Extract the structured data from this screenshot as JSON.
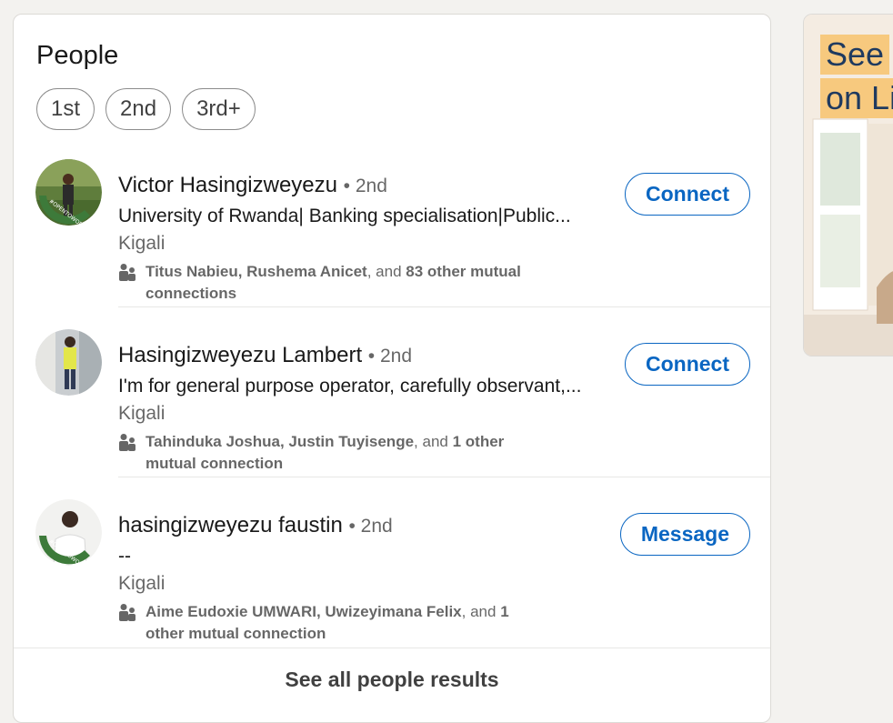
{
  "people_card": {
    "title": "People",
    "filters": [
      "1st",
      "2nd",
      "3rd+"
    ],
    "results": [
      {
        "name": "Victor Hasingizweyezu",
        "degree": "• 2nd",
        "headline": "University of Rwanda| Banking specialisation|Public...",
        "location": "Kigali",
        "mutual_names": "Titus Nabieu, Rushema Anicet",
        "mutual_joiner": ", and ",
        "mutual_count": "83 other mutual connections",
        "action": "Connect",
        "avatar_badge": "#OPENTOWORK"
      },
      {
        "name": "Hasingizweyezu Lambert",
        "degree": "• 2nd",
        "headline": "I'm for general purpose operator, carefully observant,...",
        "location": "Kigali",
        "mutual_names": "Tahinduka Joshua, Justin Tuyisenge",
        "mutual_joiner": ", and ",
        "mutual_count": "1 other mutual connection",
        "action": "Connect",
        "avatar_badge": ""
      },
      {
        "name": "hasingizweyezu faustin",
        "degree": "• 2nd",
        "headline": "--",
        "location": "Kigali",
        "mutual_names": "Aime Eudoxie UMWARI, Uwizeyimana Felix",
        "mutual_joiner": ", and ",
        "mutual_count": "1 other mutual connection",
        "action": "Message",
        "avatar_badge": "#OPENTOWORK"
      }
    ],
    "see_all": "See all people results"
  },
  "ad": {
    "line1": "See",
    "line2": "on Li"
  },
  "colors": {
    "accent": "#0a66c2",
    "opentowork": "#3d7a3a",
    "background": "#f3f2ef"
  }
}
